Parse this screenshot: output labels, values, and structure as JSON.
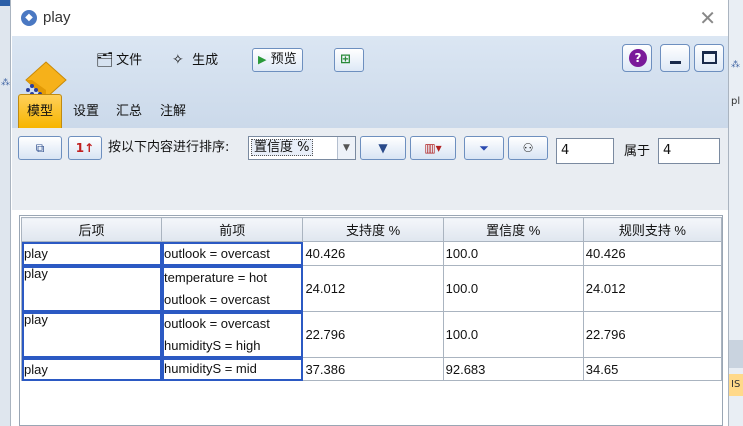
{
  "window": {
    "title": "play",
    "close_glyph": "✕"
  },
  "toolbar": {
    "file_label": "文件",
    "generate_label": "生成",
    "preview_label": "预览",
    "help_glyph": "?"
  },
  "tabs": [
    {
      "label": "模型",
      "active": true
    },
    {
      "label": "设置",
      "active": false
    },
    {
      "label": "汇总",
      "active": false
    },
    {
      "label": "注解",
      "active": false
    }
  ],
  "sortbar": {
    "sort_label": "按以下内容进行排序:",
    "sort_value": "置信度 %",
    "count_value": "4",
    "of_label": "属于",
    "total_value": "4"
  },
  "table": {
    "columns": [
      "后项",
      "前项",
      "支持度 %",
      "置信度 %",
      "规则支持 %"
    ],
    "rows": [
      {
        "consequent": "play",
        "antecedents": [
          "outlook = overcast"
        ],
        "support": "40.426",
        "confidence": "100.0",
        "rule_support": "40.426"
      },
      {
        "consequent": "play",
        "antecedents": [
          "temperature = hot",
          "outlook = overcast"
        ],
        "support": "24.012",
        "confidence": "100.0",
        "rule_support": "24.012"
      },
      {
        "consequent": "play",
        "antecedents": [
          "outlook = overcast",
          "humidityS = high"
        ],
        "support": "22.796",
        "confidence": "100.0",
        "rule_support": "22.796"
      },
      {
        "consequent": "play",
        "antecedents": [
          "humidityS = mid"
        ],
        "support": "37.386",
        "confidence": "92.683",
        "rule_support": "34.65"
      }
    ]
  },
  "background": {
    "right_text_pl": "pl",
    "right_text_is": "IS"
  },
  "colors": {
    "accent_tab": "#f7b500",
    "panel_blue": "#dbe6f3",
    "selection_border": "#2b59c3"
  }
}
